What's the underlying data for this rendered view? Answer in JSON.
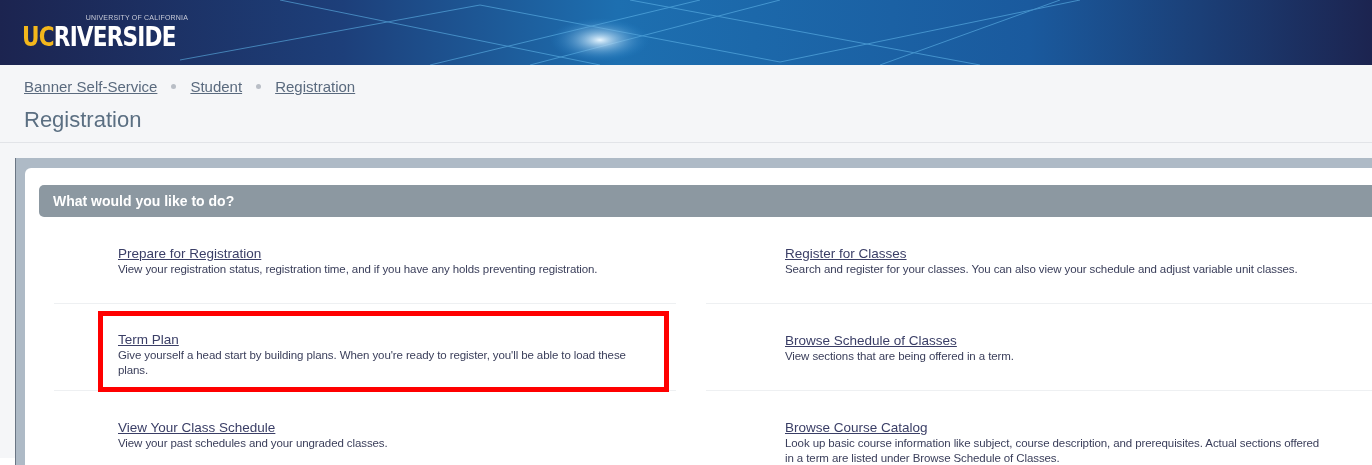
{
  "header": {
    "logo_small": "UNIVERSITY OF CALIFORNIA",
    "logo_uc": "UC",
    "logo_name": "RIVERSIDE"
  },
  "breadcrumbs": [
    "Banner Self-Service",
    "Student",
    "Registration"
  ],
  "page_title": "Registration",
  "panel": {
    "title": "What would you like to do?",
    "items": [
      {
        "title": "Prepare for Registration",
        "description": "View your registration status, registration time, and if you have any holds preventing registration.",
        "highlighted": false
      },
      {
        "title": "Register for Classes",
        "description": "Search and register for your classes. You can also view your schedule and adjust variable unit classes.",
        "highlighted": false
      },
      {
        "title": "Term Plan",
        "description": "Give yourself a head start by building plans. When you're ready to register, you'll be able to load these plans.",
        "highlighted": true
      },
      {
        "title": "Browse Schedule of Classes",
        "description": "View sections that are being offered in a term.",
        "highlighted": false
      },
      {
        "title": "View Your Class Schedule",
        "description": "View your past schedules and your ungraded classes.",
        "highlighted": false
      },
      {
        "title": "Browse Course Catalog",
        "description": "Look up basic course information like subject, course description, and prerequisites. Actual sections offered in a term are listed under Browse Schedule of Classes.",
        "highlighted": false
      }
    ]
  }
}
